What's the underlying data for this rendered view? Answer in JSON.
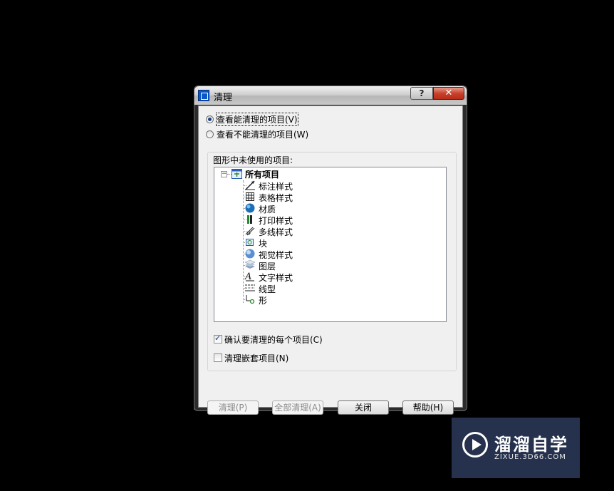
{
  "window": {
    "title": "清理",
    "help_button": "?",
    "close_button": "✕"
  },
  "view_options": [
    {
      "label": "查看能清理的项目(V)",
      "selected": true
    },
    {
      "label": "查看不能清理的项目(W)",
      "selected": false
    }
  ],
  "tree": {
    "group_label": "图形中未使用的项目:",
    "root_label": "所有项目",
    "items": [
      {
        "label": "标注样式",
        "icon": "dimension-style-icon"
      },
      {
        "label": "表格样式",
        "icon": "table-style-icon"
      },
      {
        "label": "材质",
        "icon": "material-icon"
      },
      {
        "label": "打印样式",
        "icon": "plot-style-icon"
      },
      {
        "label": "多线样式",
        "icon": "multiline-style-icon"
      },
      {
        "label": "块",
        "icon": "block-icon"
      },
      {
        "label": "视觉样式",
        "icon": "visual-style-icon"
      },
      {
        "label": "图层",
        "icon": "layer-icon"
      },
      {
        "label": "文字样式",
        "icon": "text-style-icon"
      },
      {
        "label": "线型",
        "icon": "linetype-icon"
      },
      {
        "label": "形",
        "icon": "shape-icon"
      }
    ]
  },
  "checkboxes": [
    {
      "label": "确认要清理的每个项目(C)",
      "checked": true
    },
    {
      "label": "清理嵌套项目(N)",
      "checked": false
    }
  ],
  "buttons": {
    "purge": "清理(P)",
    "purge_all": "全部清理(A)",
    "close": "关闭",
    "help": "帮助(H)"
  },
  "watermark": {
    "title": "溜溜自学",
    "subtitle": "ZIXUE.3D66.COM"
  }
}
